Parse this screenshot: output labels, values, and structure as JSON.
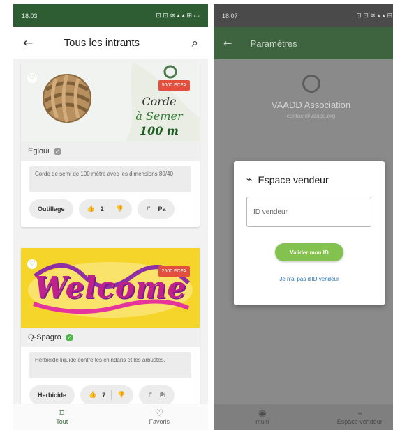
{
  "left": {
    "status": {
      "time": "18:03",
      "icons": "◂ ⚙",
      "right_icons": "⊡ ⊡ ≋ ▴ ▴ ⊞ ▭"
    },
    "appbar": {
      "back_icon": "←",
      "title": "Tous les intrants",
      "search_icon": "⌕"
    },
    "cards": [
      {
        "price": "5000 FCFA",
        "image_text": [
          "Corde",
          "à Semer",
          "100 m"
        ],
        "seller": "Egloui",
        "verified_color": "#9a9a9a",
        "description": "Corde de semi de 100 mètre avec les dimensions 80/40",
        "category": "Outillage",
        "likes": "2",
        "share_label": "Pa"
      },
      {
        "price": "2500 FCFA",
        "image_text": [
          "Welcome"
        ],
        "seller": "Q-Spagro",
        "verified_color": "#4fb548",
        "description": "Herbicide liquide contre les chindans et les arbustes.",
        "category": "Herbicide",
        "likes": "7",
        "share_label": "Pi"
      }
    ],
    "nav": [
      {
        "label": "Tout",
        "icon": "⌑",
        "active": true
      },
      {
        "label": "Favoris",
        "icon": "♡",
        "active": false
      }
    ]
  },
  "right": {
    "status": {
      "time": "18:07",
      "icons": "◂ ⚙",
      "right_icons": "⊡ ⊡ ≋ ▴ ▴ ⊞ ▭"
    },
    "appbar": {
      "back_icon": "←",
      "title": "Paramètres"
    },
    "profile": {
      "name": "VAADD Association",
      "email": "contact@vaadd.org"
    },
    "dialog": {
      "title": "Espace vendeur",
      "input_placeholder": "ID vendeur",
      "validate_label": "Valider mon ID",
      "no_vendor_link": "Je n'ai pas d'ID vendeur"
    },
    "nav": [
      {
        "label": "multi",
        "icon": "◉"
      },
      {
        "label": "Espace vendeur",
        "icon": "⌁"
      }
    ]
  },
  "colors": {
    "primary_dark": "#2f5d33",
    "accent_green": "#84c24f",
    "price_red": "#e24f3e",
    "link_blue": "#2574b8"
  }
}
